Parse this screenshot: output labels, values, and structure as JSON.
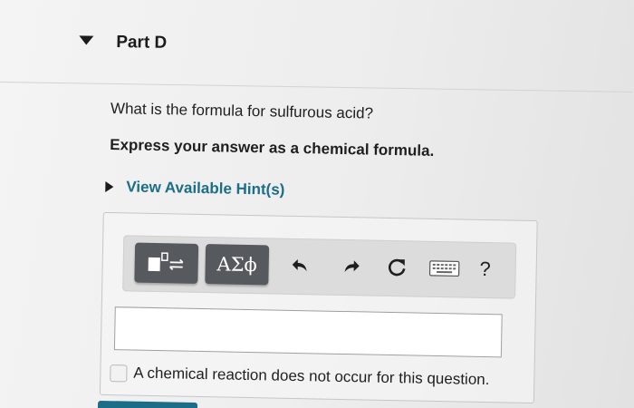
{
  "part": {
    "title": "Part D"
  },
  "question": {
    "text": "What is the formula for sulfurous acid?",
    "instruction": "Express your answer as a chemical formula."
  },
  "hints": {
    "label": "View Available Hint(s)"
  },
  "toolbar": {
    "templates_icon": "templates-icon",
    "greek_label": "ΑΣϕ",
    "undo_icon": "undo-icon",
    "redo_icon": "redo-icon",
    "reset_icon": "reset-icon",
    "keyboard_icon": "keyboard-icon",
    "help_label": "?"
  },
  "answer": {
    "value": "",
    "placeholder": ""
  },
  "no_reaction": {
    "label": "A chemical reaction does not occur for this question.",
    "checked": false
  },
  "colors": {
    "link": "#1c6e88",
    "tool_button": "#565a5e",
    "text": "#1f1f1f"
  }
}
